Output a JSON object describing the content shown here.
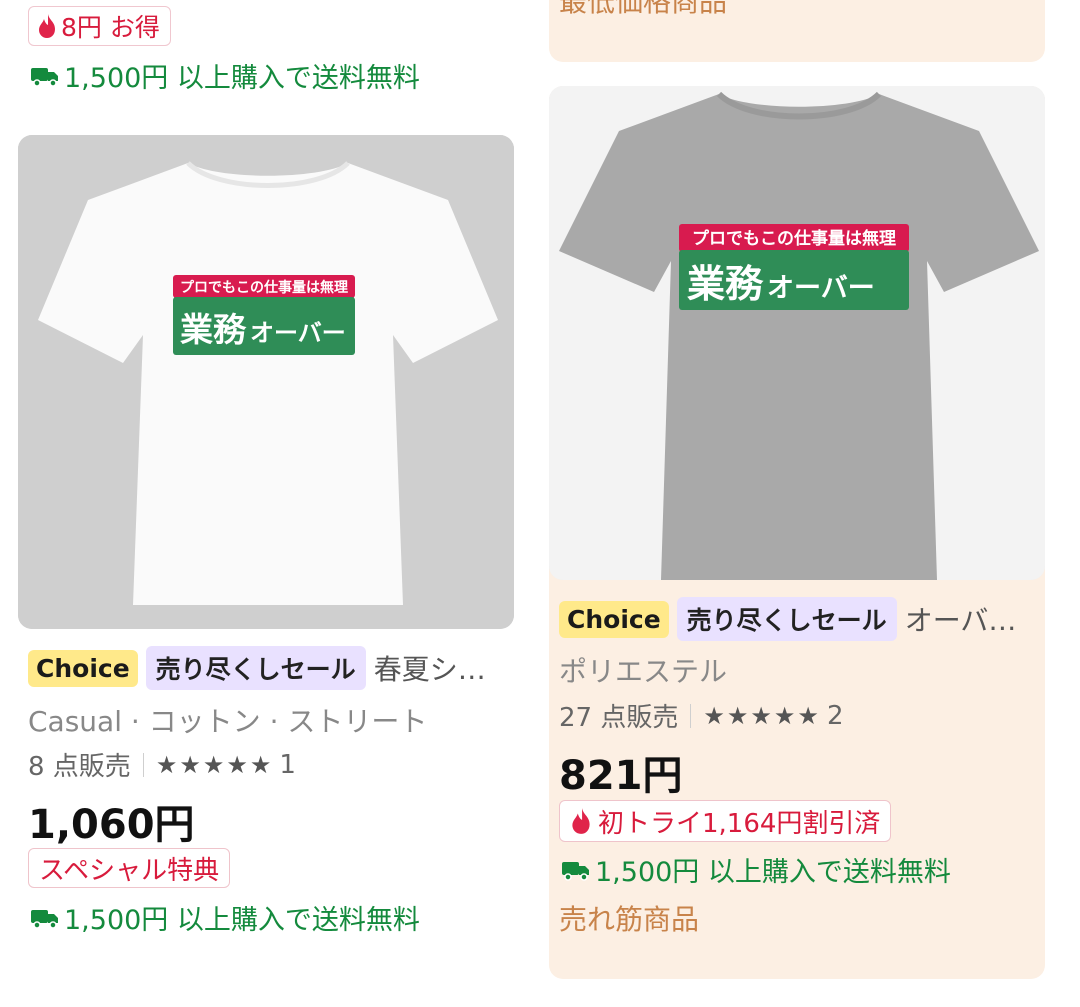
{
  "top": {
    "left_badge": "8円 お得",
    "left_ship": "1,500円 以上購入で送料無料",
    "right_cut_label": "最低価格商品"
  },
  "products": [
    {
      "tags": {
        "choice": "Choice",
        "sale": "売り尽くしセール"
      },
      "title": "春夏シ…",
      "subtitle": "Casual · コットン · ストリート",
      "sold": "8 点販売",
      "rating_count": "1",
      "price": "1,060円",
      "promo": "スペシャル特典",
      "shipping": "1,500円 以上購入で送料無料",
      "print_top": "プロでもこの仕事量は無理",
      "print_main": "業務",
      "print_main_small": "オーバー"
    },
    {
      "tags": {
        "choice": "Choice",
        "sale": "売り尽くしセール"
      },
      "title": "オーバ…",
      "subtitle": "ポリエステル",
      "sold": "27 点販売",
      "rating_count": "2",
      "price": "821円",
      "promo": "初トライ1,164円割引済",
      "shipping": "1,500円 以上購入で送料無料",
      "bestseller": "売れ筋商品",
      "print_top": "プロでもこの仕事量は無理",
      "print_main": "業務",
      "print_main_small": "オーバー"
    }
  ],
  "colors": {
    "accent_red": "#d81b3c",
    "ship_green": "#148a3d",
    "choice_yellow": "#ffe98a",
    "sale_lavender": "#e9e1ff",
    "card_peach": "#fcefe3"
  },
  "icons": {
    "flame": "flame-icon",
    "truck": "truck-icon",
    "star": "star-icon"
  }
}
